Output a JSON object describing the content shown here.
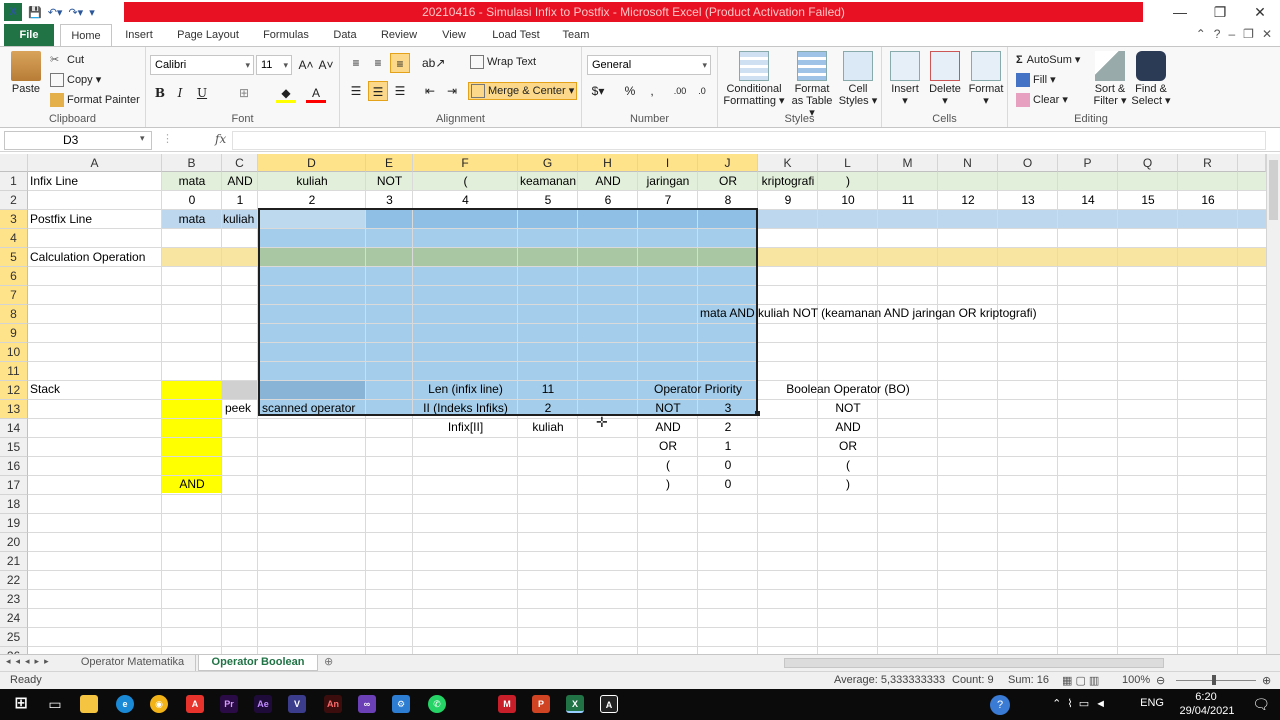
{
  "window": {
    "title": "20210416 - Simulasi Infix to Postfix  -  Microsoft Excel (Product Activation Failed)",
    "controls": [
      "—",
      "❐",
      "✕"
    ]
  },
  "ribbon_tabs": [
    "File",
    "Home",
    "Insert",
    "Page Layout",
    "Formulas",
    "Data",
    "Review",
    "View",
    "Load Test",
    "Team"
  ],
  "clipboard": {
    "paste": "Paste",
    "cut": "Cut",
    "copy": "Copy",
    "format_painter": "Format Painter",
    "label": "Clipboard"
  },
  "font": {
    "name": "Calibri",
    "size": "11",
    "label": "Font",
    "bold": "B",
    "italic": "I",
    "underline": "U"
  },
  "alignment": {
    "wrap_text": "Wrap Text",
    "merge_center": "Merge & Center",
    "label": "Alignment"
  },
  "number": {
    "format": "General",
    "percent": "%",
    "comma": ",",
    "label": "Number"
  },
  "styles": {
    "conditional": "Conditional",
    "conditional2": "Formatting",
    "format_table": "Format",
    "format_table2": "as Table",
    "cell_styles": "Cell",
    "cell_styles2": "Styles",
    "label": "Styles"
  },
  "cells": {
    "insert": "Insert",
    "delete": "Delete",
    "format": "Format",
    "label": "Cells"
  },
  "editing": {
    "autosum": "AutoSum",
    "fill": "Fill",
    "clear": "Clear",
    "sort": "Sort &",
    "sort2": "Filter",
    "find": "Find &",
    "find2": "Select",
    "label": "Editing"
  },
  "formula_bar": {
    "name_box": "D3",
    "fx": "fx",
    "formula": ""
  },
  "columns": [
    "A",
    "B",
    "C",
    "D",
    "E",
    "F",
    "G",
    "H",
    "I",
    "J",
    "K",
    "L",
    "M",
    "N",
    "O",
    "P",
    "Q",
    "R"
  ],
  "rows": [
    "1",
    "2",
    "3",
    "4",
    "5",
    "6",
    "7",
    "8",
    "9",
    "10",
    "11",
    "12",
    "13",
    "14",
    "15",
    "16",
    "17",
    "18",
    "19",
    "20",
    "21",
    "22",
    "23",
    "24",
    "25",
    "26"
  ],
  "cells_text": {
    "A1": "Infix Line",
    "B1": "mata",
    "C1": "AND",
    "D1": "kuliah",
    "E1": "NOT",
    "F1": "(",
    "G1": "keamanan",
    "H1": "AND",
    "I1": "jaringan",
    "J1": "OR",
    "K1": "kriptografi",
    "L1": ")",
    "B2": "0",
    "C2": "1",
    "D2": "2",
    "E2": "3",
    "F2": "4",
    "G2": "5",
    "H2": "6",
    "I2": "7",
    "J2": "8",
    "K2": "9",
    "L2": "10",
    "M2": "11",
    "N2": "12",
    "O2": "13",
    "P2": "14",
    "Q2": "15",
    "R2": "16",
    "A3": "Postfix Line",
    "B3": "mata",
    "C3": "kuliah",
    "A5": "Calculation Operation",
    "J8": "mata AND kuliah NOT (keamanan AND jaringan OR kriptografi)",
    "A12": "Stack",
    "F12": "Len (infix line)",
    "G12": "11",
    "I12": "Operator Priority",
    "K12": "Boolean Operator (BO)",
    "C13": "peek",
    "D13": "scanned operator",
    "F13": "II (Indeks Infiks)",
    "G13": "2",
    "I13": "NOT",
    "J13": "3",
    "L13": "NOT",
    "F14": "Infix[II]",
    "G14": "kuliah",
    "I14": "AND",
    "J14": "2",
    "L14": "AND",
    "I15": "OR",
    "J15": "1",
    "L15": "OR",
    "I16": "(",
    "J16": "0",
    "L16": "(",
    "B17": "AND",
    "I17": ")",
    "J17": "0",
    "L17": ")"
  },
  "sheet_tabs": [
    "Operator Matematika",
    "Operator Boolean"
  ],
  "active_sheet": "Operator Boolean",
  "status": {
    "ready": "Ready",
    "average": "Average: 5,333333333",
    "count": "Count: 9",
    "sum": "Sum: 16",
    "zoom": "100%"
  },
  "taskbar": {
    "language": "ENG",
    "time": "6:20",
    "date": "29/04/2021"
  },
  "colors": {
    "excel_green": "#217346",
    "title_red": "#e81123",
    "selection_blue": "#a3cdea",
    "header_highlight": "#ffe38a",
    "yellow": "#ffff00",
    "light_green": "#e2efda",
    "light_blue": "#bdd7ee",
    "sand": "#f8e5a1"
  }
}
